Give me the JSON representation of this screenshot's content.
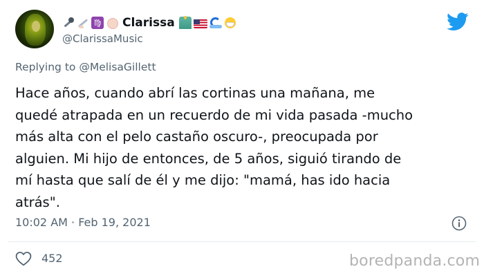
{
  "author": {
    "display_name": "Clarissa",
    "handle": "@ClarissaMusic",
    "emoji_before_name": [
      "microphone-emoji",
      "writing-hand-emoji",
      "virgo-emoji",
      "raised-fist-emoji"
    ],
    "emoji_after_name": [
      "statue-of-liberty-emoji",
      "us-flag-emoji",
      "wave-emoji",
      "face-mask-emoji"
    ]
  },
  "reply": {
    "prefix": "Replying to",
    "mention": "@MelisaGillett"
  },
  "tweet": {
    "lines": [
      "Hace años, cuando abrí las cortinas una mañana, me",
      "quedé atrapada en un recuerdo de mi vida pasada -mucho",
      "más alta con el pelo castaño oscuro-, preocupada por",
      "alguien. Mi hijo de entonces, de 5 años, siguió tirando de",
      "mí hasta que salí de él y me dijo: \"mamá, has ido hacia",
      "atrás\"."
    ],
    "timestamp": "10:02 AM · Feb 19, 2021"
  },
  "stats": {
    "likes": "452"
  },
  "watermark": "boredpanda.com",
  "colors": {
    "twitter_blue": "#1d9bf0",
    "text_primary": "#0f1419",
    "text_secondary": "#536471",
    "watermark": "#b3b3b3"
  },
  "icons": {
    "brand": "twitter-bird-icon",
    "info": "info-icon",
    "like": "heart-icon"
  }
}
